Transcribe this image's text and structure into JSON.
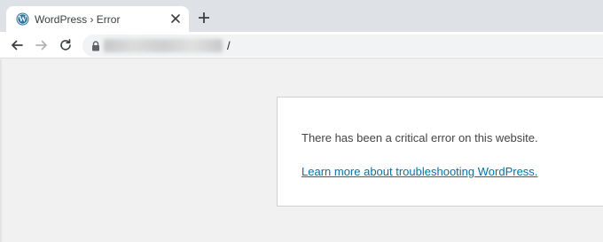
{
  "tab": {
    "title": "WordPress › Error",
    "favicon": "wordpress-icon",
    "close_icon": "close-icon"
  },
  "toolbar": {
    "back_icon": "arrow-left-icon",
    "forward_icon": "arrow-right-icon",
    "reload_icon": "reload-icon",
    "lock_icon": "lock-icon",
    "url_suffix": "/"
  },
  "page": {
    "error_message": "There has been a critical error on this website.",
    "link_text": "Learn more about troubleshooting WordPress."
  },
  "colors": {
    "link": "#0073aa",
    "wordpress_blue": "#21759b"
  }
}
